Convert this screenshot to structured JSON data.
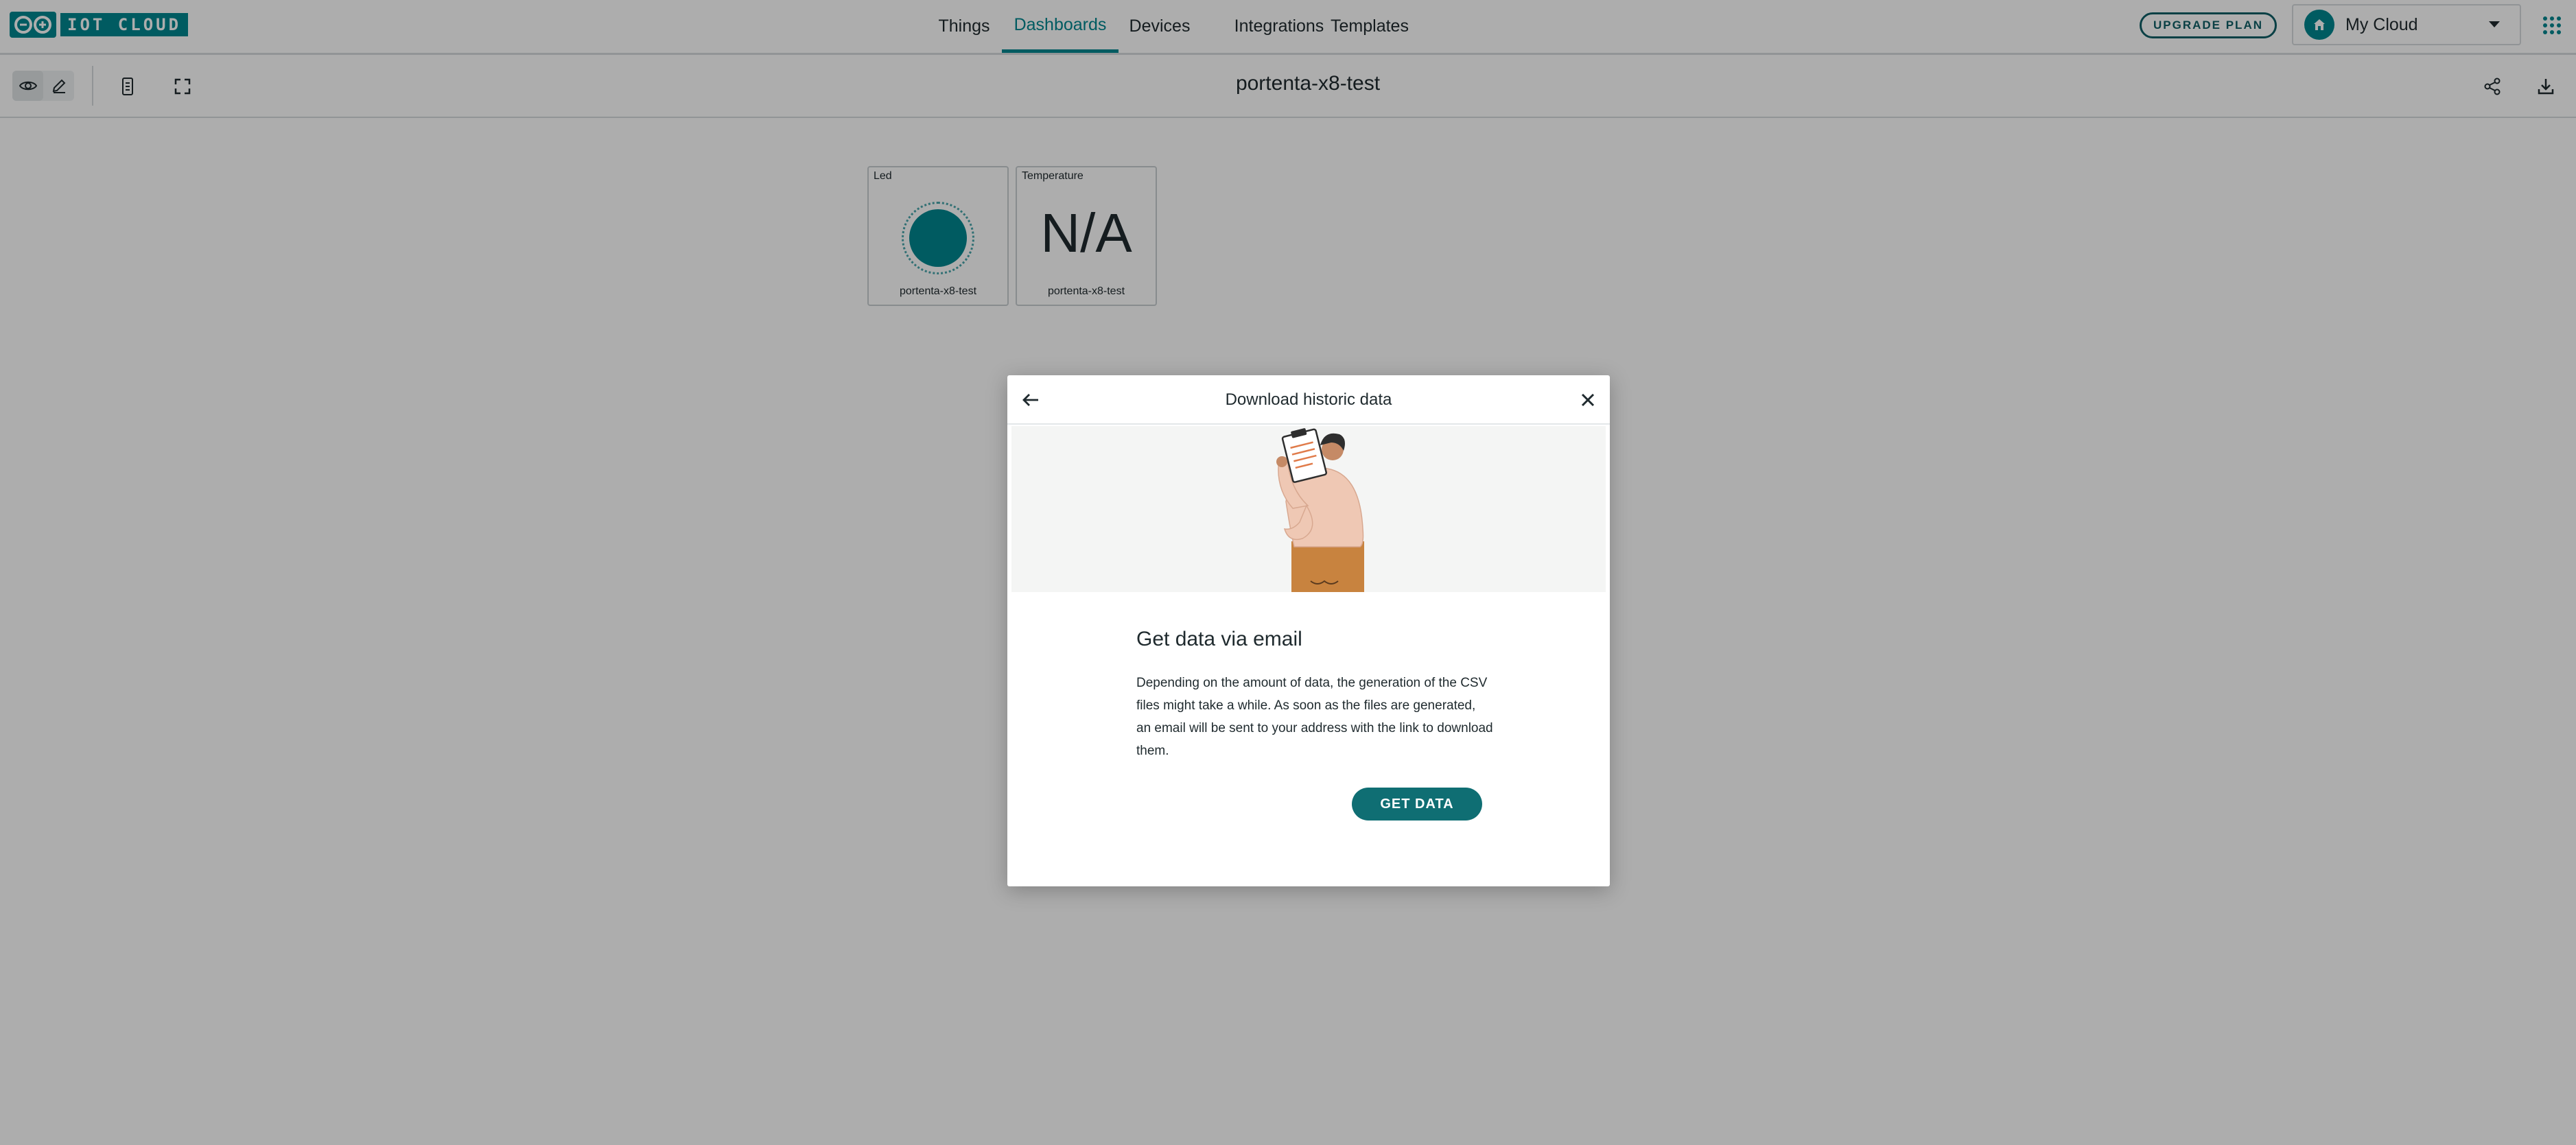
{
  "app": {
    "logo_text": "IOT CLOUD",
    "brand_color": "#00878f",
    "nav": [
      {
        "label": "Things",
        "active": false
      },
      {
        "label": "Dashboards",
        "active": true
      },
      {
        "label": "Devices",
        "active": false
      },
      {
        "label": "Integrations",
        "active": false
      },
      {
        "label": "Templates",
        "active": false
      }
    ],
    "upgrade_label": "UPGRADE PLAN",
    "cloud_label": "My Cloud"
  },
  "toolbar": {
    "dashboard_title": "portenta-x8-test",
    "icons": [
      "eye-icon",
      "pencil-icon",
      "mobile-icon",
      "fullscreen-icon",
      "share-icon",
      "download-icon"
    ]
  },
  "widgets": [
    {
      "title": "Led",
      "device": "portenta-x8-test",
      "type": "led",
      "color": "#00878f"
    },
    {
      "title": "Temperature",
      "device": "portenta-x8-test",
      "type": "value",
      "value": "N/A"
    }
  ],
  "modal": {
    "title": "Download historic data",
    "heading": "Get data via email",
    "body": "Depending on the amount of data, the generation of the CSV files might take a while. As soon as the files are generated, an email will be sent to your address with the link to download them.",
    "button_label": "GET DATA",
    "button_color": "#0f6e73"
  }
}
